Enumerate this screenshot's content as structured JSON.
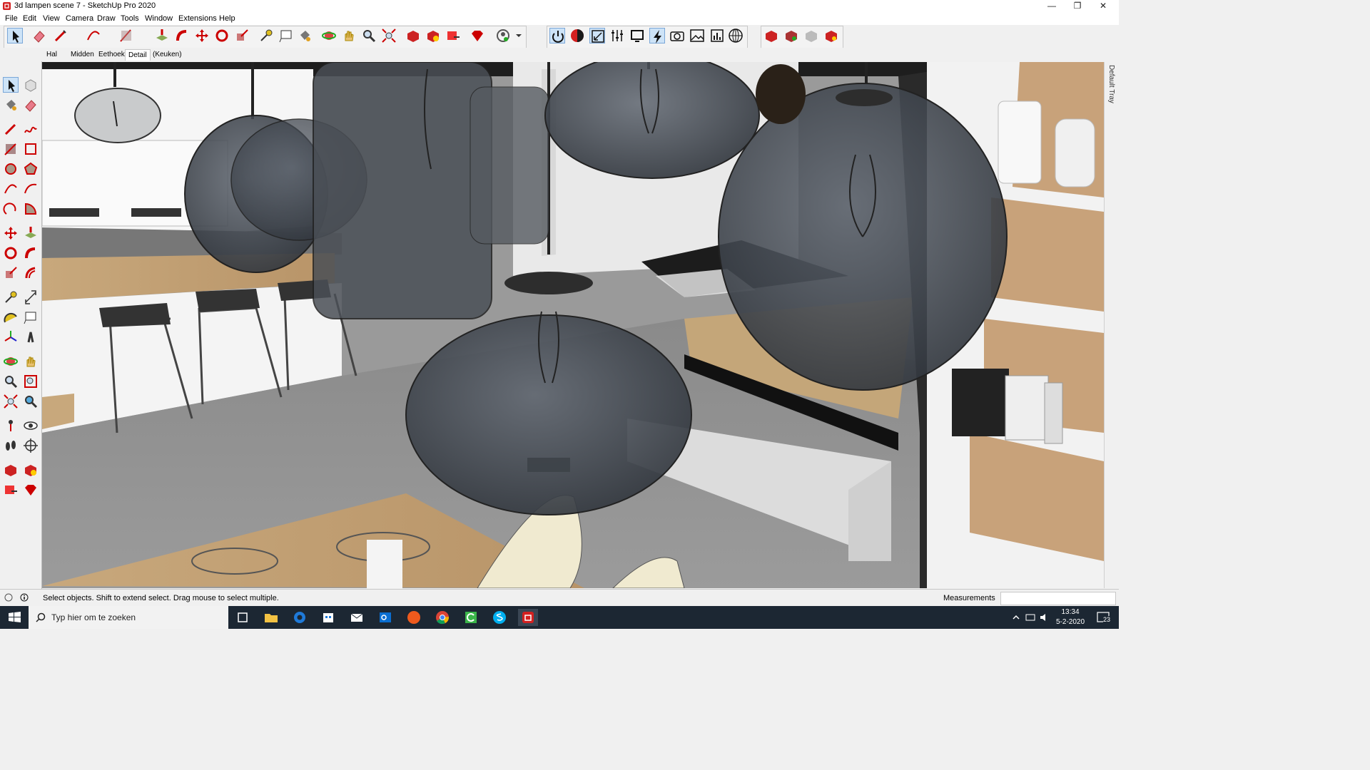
{
  "window": {
    "title": "3d lampen scene 7 - SketchUp Pro 2020",
    "controls": {
      "minimize": "—",
      "restore": "❐",
      "close": "✕"
    }
  },
  "menu": [
    "File",
    "Edit",
    "View",
    "Camera",
    "Draw",
    "Tools",
    "Window",
    "Extensions",
    "Help"
  ],
  "scenes": [
    "Hal",
    "Midden",
    "Eethoek",
    "Detail",
    "(Keuken)"
  ],
  "active_scene": "Detail",
  "tray": {
    "label": "Default Tray"
  },
  "status": {
    "text": "Select objects. Shift to extend select. Drag mouse to select multiple.",
    "measurements_label": "Measurements",
    "measurements_value": ""
  },
  "taskbar": {
    "search_placeholder": "Typ hier om te zoeken",
    "time": "13:34",
    "date": "5-2-2020",
    "notification_count": "23"
  },
  "toolbar_icons": [
    "select-icon",
    "eraser-icon",
    "line-icon",
    "arc-icon",
    "rectangle-icon",
    "push-pull-icon",
    "follow-me-icon",
    "move-icon",
    "rotate-icon",
    "scale-icon",
    "tape-measure-icon",
    "text-icon",
    "paint-bucket-icon",
    "orbit-icon",
    "pan-icon",
    "zoom-icon",
    "zoom-extents-icon",
    "3d-warehouse-icon",
    "extension-warehouse-icon",
    "layout-send-icon",
    "extension-manager-icon",
    "account-icon",
    "power-icon",
    "render-icon",
    "scale-window-icon",
    "settings-sliders-icon",
    "region-icon",
    "lightning-icon",
    "camera-icon",
    "image-editor-icon",
    "stats-icon",
    "globe-icon",
    "plugin-a-icon",
    "plugin-b-icon",
    "plugin-c-icon",
    "plugin-d-icon"
  ],
  "colors": {
    "accent_red": "#d32020",
    "selection_blue": "#cde3f7",
    "taskbar": "#1c2733"
  }
}
